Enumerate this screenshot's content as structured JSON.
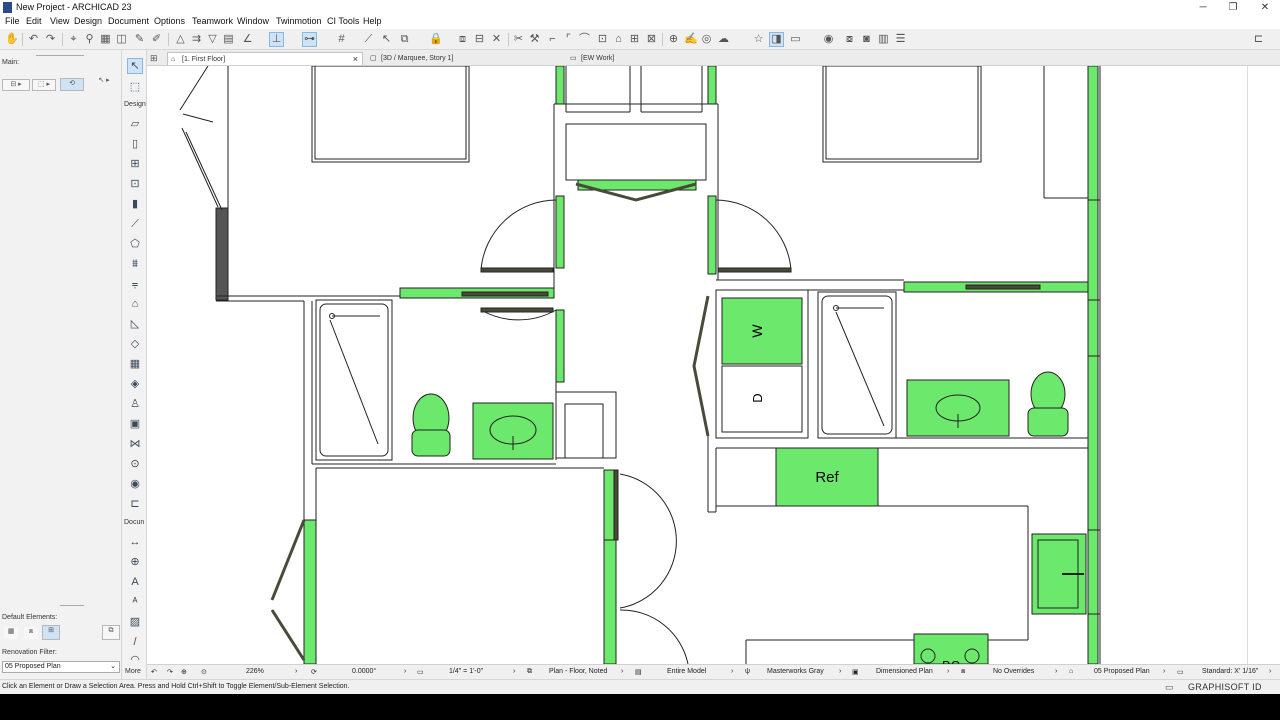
{
  "window": {
    "title": "New Project - ARCHICAD 23",
    "minimize_glyph": "─",
    "restore_glyph": "❐",
    "close_glyph": "✕"
  },
  "menu": [
    "File",
    "Edit",
    "View",
    "Design",
    "Document",
    "Options",
    "Teamwork",
    "Window",
    "Twinmotion",
    "CI Tools",
    "Help"
  ],
  "infobox": {
    "main_label": "Main:",
    "default_elements_label": "Default Elements:",
    "renovation_filter_label": "Renovation Filter:",
    "renovation_filter_value": "05 Proposed Plan"
  },
  "toolbox": {
    "design_label": "Design",
    "document_label": "Docun",
    "more_label": "More"
  },
  "tabs": [
    {
      "label": "[1. First Floor]",
      "close": "×"
    },
    {
      "label": "[3D / Marquee, Story 1]"
    },
    {
      "label": "[EW Work]"
    }
  ],
  "plan": {
    "labels": {
      "washer": "W",
      "dryer": "D",
      "refrigerator": "Ref",
      "partial": "BC"
    },
    "accent_green": "#6ce86c",
    "wall_dark": "#4a4a3a"
  },
  "nav_status": {
    "zoom": "226%",
    "angle": "0.0000°",
    "scale": "1/4\"    =    1'-0\"",
    "view": "Plan - Floor, Noted",
    "model": "Entire Model",
    "pen_set": "Masterworks Gray",
    "mvo": "Dimensioned Plan",
    "overrides": "No Overrides",
    "renovation": "05 Proposed Plan",
    "dimension": "Standard: X' 1/16\""
  },
  "status_message": "Click an Element or Draw a Selection Area. Press and Hold Ctrl+Shift to Toggle Element/Sub-Element Selection.",
  "brand": "GRAPHISOFT ID"
}
